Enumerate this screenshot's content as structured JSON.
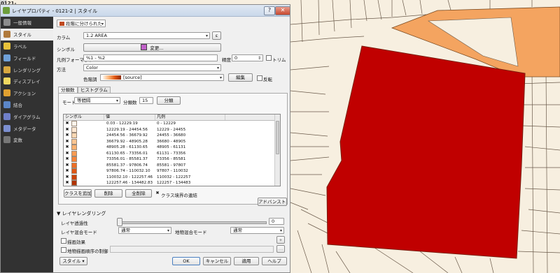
{
  "colors": {
    "feature_fill": "#c00000",
    "feature_stroke": "#7a1d0e",
    "tan_fill": "#f4a460",
    "map_bg": "#f7efe0"
  },
  "parent_window": {
    "title": "0121-2"
  },
  "dialog": {
    "title": "レイヤプロパティ - 0121-2 | スタイル",
    "help_button": "?",
    "close_button": "✕"
  },
  "sidebar": {
    "items": [
      {
        "label": "一般情報",
        "icon": "wrench-icon",
        "color": "#8c8c8c"
      },
      {
        "label": "スタイル",
        "icon": "paintbrush-icon",
        "color": "#b07a3c"
      },
      {
        "label": "ラベル",
        "icon": "abc-label-icon",
        "color": "#e8c23a"
      },
      {
        "label": "フィールド",
        "icon": "table-icon",
        "color": "#6fa0d8"
      },
      {
        "label": "レンダリング",
        "icon": "brush-icon",
        "color": "#d8a840"
      },
      {
        "label": "ディスプレイ",
        "icon": "speech-bubble-icon",
        "color": "#f0d860"
      },
      {
        "label": "アクション",
        "icon": "gear-icon",
        "color": "#e0a030"
      },
      {
        "label": "結合",
        "icon": "join-icon",
        "color": "#5b86c8"
      },
      {
        "label": "ダイアグラム",
        "icon": "diagram-icon",
        "color": "#6f7fc8"
      },
      {
        "label": "メタデータ",
        "icon": "info-icon",
        "color": "#7c8fd0"
      },
      {
        "label": "変数",
        "icon": "variable-icon",
        "color": "#777777"
      }
    ]
  },
  "style": {
    "renderer": "段階に分けられた",
    "column_label": "カラム",
    "column_value": "1.2  AREA",
    "expr_button": "ε",
    "symbol_label": "シンボル",
    "change_button": "変更...",
    "legend_format_label": "凡例フォーマット",
    "legend_format_value": "%1 - %2",
    "precision_label": "精度",
    "precision_value": "0",
    "trim_label": "トリム",
    "method_label": "方法",
    "method_value": "Color",
    "ramp_label": "色階調",
    "ramp_value": "[source]",
    "edit_button": "編集",
    "invert_label": "反転"
  },
  "tabs": [
    {
      "label": "分類数",
      "active": true
    },
    {
      "label": "ヒストグラム",
      "active": false
    }
  ],
  "classes": {
    "mode_label": "モード",
    "mode_value": "等間隔",
    "count_label": "分類数",
    "count_value": "15",
    "classify_button": "分類",
    "headers": [
      "シンボル",
      "値",
      "凡例"
    ],
    "rows": [
      {
        "color": "#fff5eb",
        "value": "0.03 - 12229.19",
        "legend": "0 - 12229"
      },
      {
        "color": "#fee8d3",
        "value": "12229.19 - 24454.56",
        "legend": "12229 - 24455"
      },
      {
        "color": "#fdd8b3",
        "value": "24454.56 - 36679.92",
        "legend": "24455 - 36680"
      },
      {
        "color": "#fdc591",
        "value": "36679.92 - 48905.28",
        "legend": "36680 - 48905"
      },
      {
        "color": "#fdb170",
        "value": "48905.28 - 61130.65",
        "legend": "48905 - 61131"
      },
      {
        "color": "#fb9b52",
        "value": "61130.65 - 73356.01",
        "legend": "61131 - 73356"
      },
      {
        "color": "#f78438",
        "value": "73356.01 - 85581.37",
        "legend": "73356 - 85581"
      },
      {
        "color": "#ee6d24",
        "value": "85581.37 - 97806.74",
        "legend": "85581 - 97807"
      },
      {
        "color": "#e05613",
        "value": "97806.74 - 110032.10",
        "legend": "97807 - 110032"
      },
      {
        "color": "#cc4308",
        "value": "110032.10 - 122257.46",
        "legend": "110032 - 122257"
      },
      {
        "color": "#b03304",
        "value": "122257.46 - 134482.83",
        "legend": "122257 - 134483"
      },
      {
        "color": "#952a04",
        "value": "134482.83 - 146708.19",
        "legend": "134483 - 146708"
      }
    ],
    "add_button": "クラスを追加",
    "delete_button": "削除",
    "delete_all_button": "全削除",
    "link_label": "クラス境界の連結"
  },
  "advanced_button": "アドバンスト",
  "layer_rendering": {
    "title": "レイヤレンダリング",
    "transparency_label": "レイヤ透過性",
    "transparency_value": "0",
    "blend_label": "レイヤ混合モード",
    "blend_value": "通常",
    "feature_blend_label": "地物混合モード",
    "feature_blend_value": "通常",
    "effects_label": "描画効果",
    "order_label": "地物描画順序の制御"
  },
  "footer": {
    "style_button": "スタイル",
    "ok_button": "OK",
    "cancel_button": "キャンセル",
    "apply_button": "適用",
    "help_button": "ヘルプ"
  }
}
